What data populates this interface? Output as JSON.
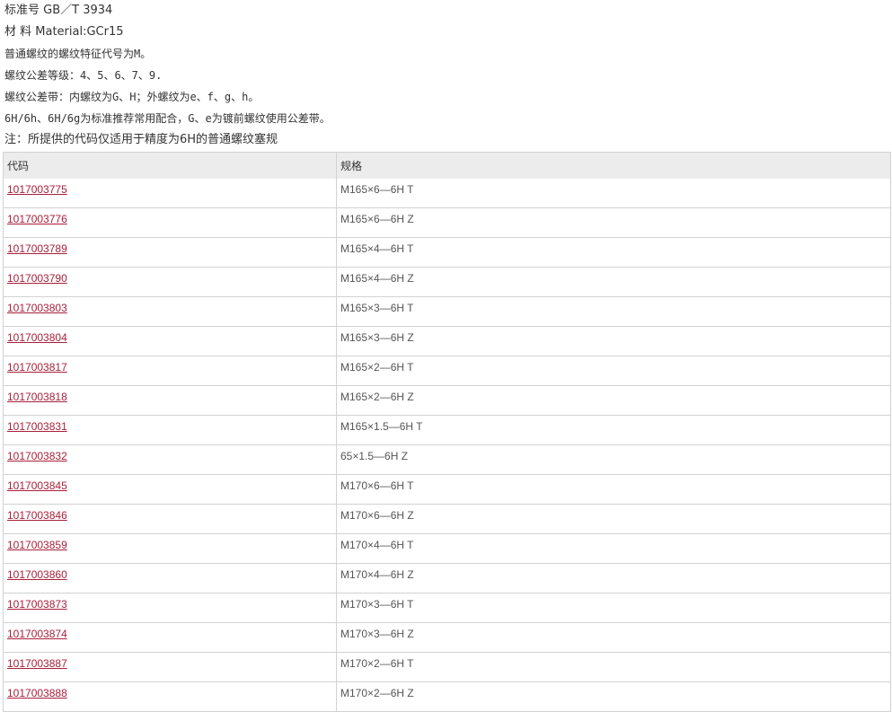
{
  "info": {
    "standard": "标准号 GB／T 3934",
    "material": "材 料 Material:GCr15",
    "line_thread_code": "普通螺纹的螺纹特征代号为M。",
    "line_tolerance_grade": "螺纹公差等级：4、5、6、7、9.",
    "line_tolerance_zone": "螺纹公差带：内螺纹为G、H；外螺纹为e、f、g、h。",
    "line_fit": "6H/6h、6H/6g为标准推荐常用配合，G、e为镀前螺纹使用公差带。",
    "note": "注：所提供的代码仅适用于精度为6H的普通螺纹塞规"
  },
  "table": {
    "headers": [
      "代码",
      "规格"
    ],
    "rows": [
      {
        "code": "1017003775",
        "spec": "M165×6—6H T"
      },
      {
        "code": "1017003776",
        "spec": "M165×6—6H Z"
      },
      {
        "code": "1017003789",
        "spec": "M165×4—6H T"
      },
      {
        "code": "1017003790",
        "spec": "M165×4—6H Z"
      },
      {
        "code": "1017003803",
        "spec": "M165×3—6H T"
      },
      {
        "code": "1017003804",
        "spec": "M165×3—6H Z"
      },
      {
        "code": "1017003817",
        "spec": "M165×2—6H T"
      },
      {
        "code": "1017003818",
        "spec": "M165×2—6H Z"
      },
      {
        "code": "1017003831",
        "spec": "M165×1.5—6H T"
      },
      {
        "code": "1017003832",
        "spec": "65×1.5—6H Z"
      },
      {
        "code": "1017003845",
        "spec": "M170×6—6H T"
      },
      {
        "code": "1017003846",
        "spec": "M170×6—6H Z"
      },
      {
        "code": "1017003859",
        "spec": "M170×4—6H T"
      },
      {
        "code": "1017003860",
        "spec": "M170×4—6H Z"
      },
      {
        "code": "1017003873",
        "spec": "M170×3—6H T"
      },
      {
        "code": "1017003874",
        "spec": "M170×3—6H Z"
      },
      {
        "code": "1017003887",
        "spec": "M170×2—6H T"
      },
      {
        "code": "1017003888",
        "spec": "M170×2—6H Z"
      }
    ]
  },
  "colors": {
    "link": "#a8203a",
    "header_bg": "#ececec",
    "border": "#d2d2d2"
  }
}
